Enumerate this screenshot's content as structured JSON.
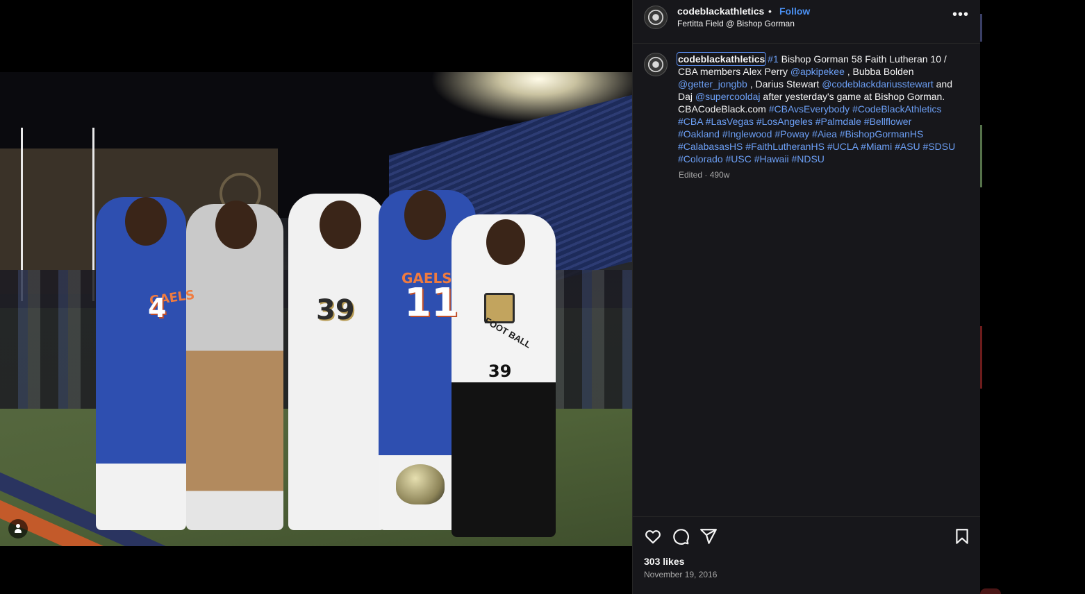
{
  "post": {
    "username": "codeblackathletics",
    "separator": "•",
    "follow_label": "Follow",
    "location": "Fertitta Field @ Bishop Gorman",
    "more_label": "•••",
    "caption": {
      "user": "codeblackathletics",
      "segments": [
        {
          "type": "link",
          "text": "#1"
        },
        {
          "type": "text",
          "text": " Bishop Gorman 58 Faith Lutheran 10 / CBA members Alex Perry "
        },
        {
          "type": "link",
          "text": "@apkipekee"
        },
        {
          "type": "text",
          "text": " , Bubba Bolden "
        },
        {
          "type": "link",
          "text": "@getter_jongbb"
        },
        {
          "type": "text",
          "text": " , Darius Stewart "
        },
        {
          "type": "link",
          "text": "@codeblackdariusstewart"
        },
        {
          "type": "text",
          "text": " and Daj "
        },
        {
          "type": "link",
          "text": "@supercooldaj"
        },
        {
          "type": "text",
          "text": " after yesterday's game at Bishop Gorman. CBACodeBlack.com "
        },
        {
          "type": "link",
          "text": "#CBAvsEverybody"
        },
        {
          "type": "text",
          "text": " "
        },
        {
          "type": "link",
          "text": "#CodeBlackAthletics"
        },
        {
          "type": "text",
          "text": " "
        },
        {
          "type": "link",
          "text": "#CBA"
        },
        {
          "type": "text",
          "text": " "
        },
        {
          "type": "link",
          "text": "#LasVegas"
        },
        {
          "type": "text",
          "text": " "
        },
        {
          "type": "link",
          "text": "#LosAngeles"
        },
        {
          "type": "text",
          "text": " "
        },
        {
          "type": "link",
          "text": "#Palmdale"
        },
        {
          "type": "text",
          "text": " "
        },
        {
          "type": "link",
          "text": "#Bellflower"
        },
        {
          "type": "text",
          "text": " "
        },
        {
          "type": "link",
          "text": "#Oakland"
        },
        {
          "type": "text",
          "text": " "
        },
        {
          "type": "link",
          "text": "#Inglewood"
        },
        {
          "type": "text",
          "text": " "
        },
        {
          "type": "link",
          "text": "#Poway"
        },
        {
          "type": "text",
          "text": " "
        },
        {
          "type": "link",
          "text": "#Aiea"
        },
        {
          "type": "text",
          "text": " "
        },
        {
          "type": "link",
          "text": "#BishopGormanHS"
        },
        {
          "type": "text",
          "text": " "
        },
        {
          "type": "link",
          "text": "#CalabasasHS"
        },
        {
          "type": "text",
          "text": " "
        },
        {
          "type": "link",
          "text": "#FaithLutheranHS"
        },
        {
          "type": "text",
          "text": " "
        },
        {
          "type": "link",
          "text": "#UCLA"
        },
        {
          "type": "text",
          "text": " "
        },
        {
          "type": "link",
          "text": "#Miami"
        },
        {
          "type": "text",
          "text": " "
        },
        {
          "type": "link",
          "text": "#ASU"
        },
        {
          "type": "text",
          "text": " "
        },
        {
          "type": "link",
          "text": "#SDSU"
        },
        {
          "type": "text",
          "text": " "
        },
        {
          "type": "link",
          "text": "#Colorado"
        },
        {
          "type": "text",
          "text": " "
        },
        {
          "type": "link",
          "text": "#USC"
        },
        {
          "type": "text",
          "text": " "
        },
        {
          "type": "link",
          "text": "#Hawaii"
        },
        {
          "type": "text",
          "text": " "
        },
        {
          "type": "link",
          "text": "#NDSU"
        }
      ]
    },
    "meta": "Edited · 490w",
    "likes": "303 likes",
    "date": "November 19, 2016"
  },
  "photo": {
    "jersey_left": "4",
    "jersey_center": "11",
    "jersey_white": "39",
    "hoodie_number": "39",
    "team_text": "GAELS",
    "hoodie_text": "FOOT BALL"
  },
  "icons": {
    "like": "heart-icon",
    "comment": "comment-icon",
    "share": "share-icon",
    "save": "bookmark-icon",
    "tag": "user-tag-icon",
    "more": "more-options-icon"
  },
  "colors": {
    "link": "#6c9ff5",
    "follow": "#4a8ff0",
    "panel_bg": "#17171b",
    "secondary_text": "#a8a8a8"
  }
}
